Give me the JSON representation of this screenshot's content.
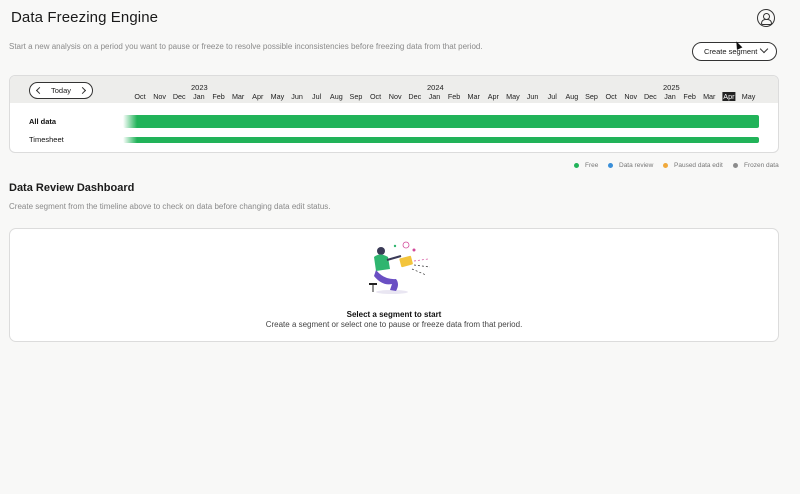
{
  "header": {
    "title": "Data Freezing Engine"
  },
  "intro": "Start a new analysis on a period you want to pause or freeze to resolve possible inconsistencies before freezing data from that period.",
  "create_segment_label": "Create segment",
  "timeline": {
    "today_label": "Today",
    "years": [
      "2023",
      "2024",
      "2025"
    ],
    "months": [
      "Oct",
      "Nov",
      "Dec",
      "Jan",
      "Feb",
      "Mar",
      "Apr",
      "May",
      "Jun",
      "Jul",
      "Aug",
      "Sep",
      "Oct",
      "Nov",
      "Dec",
      "Jan",
      "Feb",
      "Mar",
      "Apr",
      "May",
      "Jun",
      "Jul",
      "Aug",
      "Sep",
      "Oct",
      "Nov",
      "Dec",
      "Jan",
      "Feb",
      "Mar",
      "Apr",
      "May"
    ],
    "current_month_index": 30,
    "rows": [
      {
        "label": "All data",
        "status": "Free"
      },
      {
        "label": "Timesheet",
        "status": "Free"
      }
    ]
  },
  "legend": [
    {
      "label": "Free",
      "color": "#21b359"
    },
    {
      "label": "Data review",
      "color": "#3a8fd9"
    },
    {
      "label": "Paused data edit",
      "color": "#f0a93b"
    },
    {
      "label": "Frozen data",
      "color": "#8c8c8c"
    }
  ],
  "dashboard": {
    "title": "Data Review Dashboard",
    "subtitle": "Create segment from the timeline above to check on data before changing data edit status.",
    "empty_title": "Select a segment to start",
    "empty_subtitle": "Create a segment or select one to pause or freeze data from that period."
  }
}
